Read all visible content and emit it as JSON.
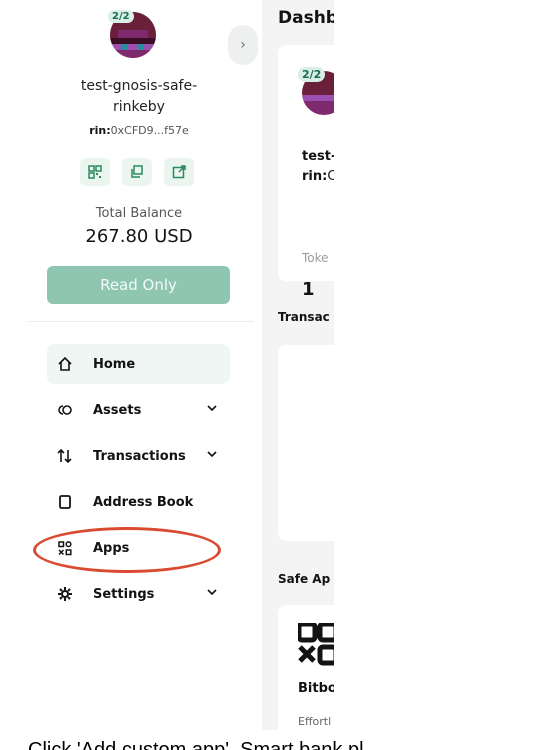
{
  "sidebar": {
    "threshold": "2/2",
    "safe_name": "test-gnosis-safe-rinkeby",
    "address_prefix": "rin:",
    "address": "0xCFD9...f57e",
    "total_balance_label": "Total Balance",
    "total_balance_value": "267.80 USD",
    "read_only_label": "Read Only",
    "collapse_icon": "chevron-right-icon",
    "nav": [
      {
        "label": "Home",
        "icon": "home-icon",
        "active": true
      },
      {
        "label": "Assets",
        "icon": "assets-icon",
        "has_submenu": true
      },
      {
        "label": "Transactions",
        "icon": "transactions-icon",
        "has_submenu": true
      },
      {
        "label": "Address Book",
        "icon": "address-book-icon"
      },
      {
        "label": "Apps",
        "icon": "apps-icon"
      },
      {
        "label": "Settings",
        "icon": "settings-icon",
        "has_submenu": true
      }
    ]
  },
  "main": {
    "title": "Dashb",
    "card": {
      "threshold": "2/2",
      "name_fragment": "test-",
      "address_fragment": "rin:",
      "tokens_label": "Toke",
      "tokens_value": "1"
    },
    "transactions_title": "Transac",
    "safe_apps_title": "Safe Ap",
    "app_name": "Bitbo",
    "app_desc": "Effortl"
  },
  "caption": "Click 'Add custom app'. Smart bank pl",
  "colors": {
    "accent": "#8fc6b2",
    "highlight": "#d94a31",
    "active_bg": "#f0f6f3"
  }
}
